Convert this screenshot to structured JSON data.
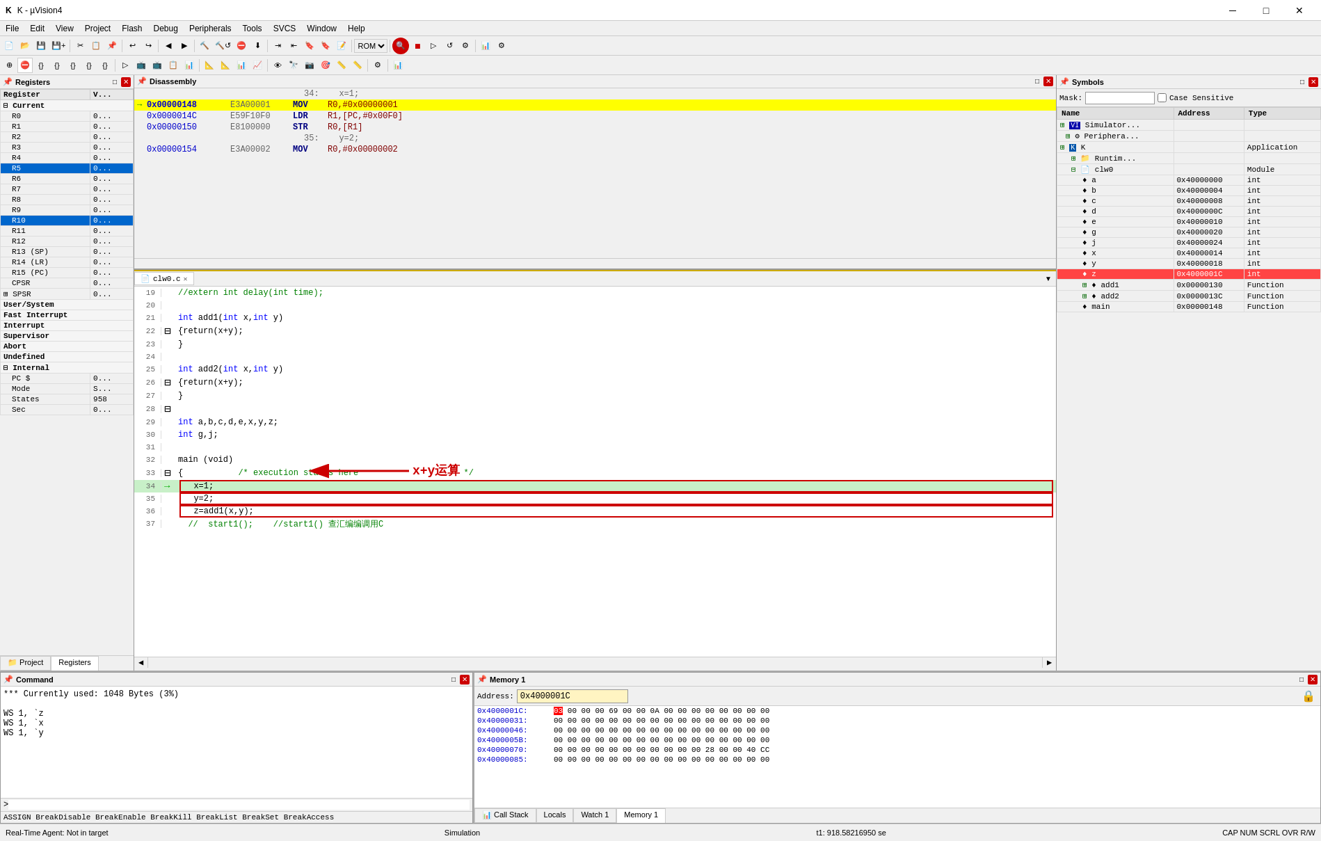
{
  "app": {
    "title": "K - µVision4",
    "icon": "K"
  },
  "menu": {
    "items": [
      "File",
      "Edit",
      "View",
      "Project",
      "Flash",
      "Debug",
      "Peripherals",
      "Tools",
      "SVCS",
      "Window",
      "Help"
    ]
  },
  "registers": {
    "title": "Registers",
    "columns": [
      "Register",
      "V..."
    ],
    "groups": [
      {
        "name": "Current",
        "items": [
          {
            "name": "R0",
            "value": "0..."
          },
          {
            "name": "R1",
            "value": "0..."
          },
          {
            "name": "R2",
            "value": "0..."
          },
          {
            "name": "R3",
            "value": "0..."
          },
          {
            "name": "R4",
            "value": "0..."
          },
          {
            "name": "R5",
            "value": "0...",
            "selected": true
          },
          {
            "name": "R6",
            "value": "0..."
          },
          {
            "name": "R7",
            "value": "0..."
          },
          {
            "name": "R8",
            "value": "0..."
          },
          {
            "name": "R9",
            "value": "0..."
          },
          {
            "name": "R10",
            "value": "0...",
            "selected": true
          },
          {
            "name": "R11",
            "value": "0..."
          },
          {
            "name": "R12",
            "value": "0..."
          },
          {
            "name": "R13 (SP)",
            "value": "0..."
          },
          {
            "name": "R14 (LR)",
            "value": "0..."
          },
          {
            "name": "R15 (PC)",
            "value": "0..."
          },
          {
            "name": "CPSR",
            "value": "0..."
          }
        ]
      },
      {
        "name": "+ SPSR",
        "value": "0..."
      },
      {
        "name": "User/System"
      },
      {
        "name": "Fast Interrupt"
      },
      {
        "name": "Interrupt"
      },
      {
        "name": "Supervisor"
      },
      {
        "name": "Abort"
      },
      {
        "name": "Undefined"
      },
      {
        "name": "Internal",
        "items": [
          {
            "name": "PC $",
            "value": "0..."
          },
          {
            "name": "Mode",
            "value": "S..."
          },
          {
            "name": "States",
            "value": "958"
          },
          {
            "name": "Sec",
            "value": "0..."
          }
        ]
      }
    ],
    "bottom_tabs": [
      "Project",
      "Registers"
    ]
  },
  "disassembly": {
    "title": "Disassembly",
    "rows": [
      {
        "lineno": "34:",
        "comment": "x=1;",
        "addr": "",
        "hex": "",
        "mnem": "",
        "ops": "",
        "type": "comment"
      },
      {
        "addr": "0x00000148",
        "hex": "E3A00001",
        "mnem": "MOV",
        "ops": "R0,#0x00000001",
        "type": "highlight-yellow"
      },
      {
        "addr": "0x0000014C",
        "hex": "E59F10F0",
        "mnem": "LDR",
        "ops": "R1,[PC,#0x00F0]",
        "type": "normal"
      },
      {
        "addr": "0x00000150",
        "hex": "E8100000",
        "mnem": "STR",
        "ops": "R0,[R1]",
        "type": "normal"
      },
      {
        "lineno": "35:",
        "comment": "y=2;",
        "addr": "",
        "hex": "",
        "mnem": "",
        "ops": "",
        "type": "comment"
      },
      {
        "addr": "0x00000154",
        "hex": "E3A00002",
        "mnem": "MOV",
        "ops": "R0,#0x00000002",
        "type": "normal"
      }
    ]
  },
  "editor": {
    "title": "clw0.c",
    "tab_label": "clw0.c",
    "lines": [
      {
        "num": 19,
        "text": "//extern int delay(int time);",
        "type": "comment"
      },
      {
        "num": 20,
        "text": ""
      },
      {
        "num": 21,
        "text": "int add1(int x,int y)",
        "type": "code"
      },
      {
        "num": 22,
        "text": "{return(x+y);",
        "type": "code",
        "fold": true
      },
      {
        "num": 23,
        "text": "}",
        "type": "code"
      },
      {
        "num": 24,
        "text": ""
      },
      {
        "num": 25,
        "text": "int add2(int x,int y)",
        "type": "code"
      },
      {
        "num": 26,
        "text": "{return(x+y);",
        "type": "code",
        "fold": true
      },
      {
        "num": 27,
        "text": "}",
        "type": "code"
      },
      {
        "num": 28,
        "text": ""
      },
      {
        "num": 29,
        "text": "int a,b,c,d,e,x,y,z;",
        "type": "code"
      },
      {
        "num": 30,
        "text": "int g,j;",
        "type": "code"
      },
      {
        "num": 31,
        "text": ""
      },
      {
        "num": 32,
        "text": "main (void)",
        "type": "code"
      },
      {
        "num": 33,
        "text": "{",
        "comment": "/* execution starts here                    */",
        "type": "code",
        "fold": true
      },
      {
        "num": 34,
        "text": "  x=1;",
        "type": "highlighted",
        "arrow": true
      },
      {
        "num": 35,
        "text": "  y=2;",
        "type": "normal"
      },
      {
        "num": 36,
        "text": "  z=add1(x,y);",
        "type": "normal"
      },
      {
        "num": 37,
        "text": "  //  start1();",
        "comment": "//start1() 查汇编调用C",
        "type": "comment"
      }
    ],
    "annotation": "x+y运算"
  },
  "symbols": {
    "title": "Symbols",
    "mask_label": "Mask:",
    "case_sensitive_label": "Case Sensitive",
    "columns": [
      "Name",
      "Address",
      "Type"
    ],
    "tree": [
      {
        "icon": "VI",
        "name": "Simulator...",
        "level": 1,
        "expand": true
      },
      {
        "icon": "gear",
        "name": "Periphera...",
        "level": 1,
        "expand": true
      },
      {
        "icon": "K",
        "name": "K",
        "level": 1,
        "expand": true,
        "value": "Application"
      },
      {
        "name": "Runtim...",
        "level": 2,
        "expand": true
      },
      {
        "name": "clw0",
        "level": 2,
        "expand": true,
        "value": "Module"
      },
      {
        "name": "a",
        "level": 3,
        "addr": "0x40000000",
        "type": "int"
      },
      {
        "name": "b",
        "level": 3,
        "addr": "0x40000004",
        "type": "int"
      },
      {
        "name": "c",
        "level": 3,
        "addr": "0x40000008",
        "type": "int"
      },
      {
        "name": "d",
        "level": 3,
        "addr": "0x4000000C",
        "type": "int"
      },
      {
        "name": "e",
        "level": 3,
        "addr": "0x40000010",
        "type": "int"
      },
      {
        "name": "g",
        "level": 3,
        "addr": "0x40000020",
        "type": "int"
      },
      {
        "name": "j",
        "level": 3,
        "addr": "0x40000024",
        "type": "int"
      },
      {
        "name": "x",
        "level": 3,
        "addr": "0x40000014",
        "type": "int"
      },
      {
        "name": "y",
        "level": 3,
        "addr": "0x40000018",
        "type": "int"
      },
      {
        "name": "z",
        "level": 3,
        "addr": "0x4000001C",
        "type": "int",
        "selected": true
      },
      {
        "name": "add1",
        "level": 3,
        "addr": "0x00000130",
        "type": "Function"
      },
      {
        "name": "add2",
        "level": 3,
        "addr": "0x0000013C",
        "type": "Function"
      },
      {
        "name": "main",
        "level": 3,
        "addr": "0x00000148",
        "type": "Function"
      }
    ]
  },
  "command": {
    "title": "Command",
    "content": [
      "*** Currently used: 1048 Bytes (3%)",
      "",
      "WS 1, `z",
      "WS 1, `x",
      "WS 1, `y"
    ],
    "autocomplete": "ASSIGN BreakDisable BreakEnable BreakKill BreakList BreakSet BreakAccess"
  },
  "memory": {
    "title": "Memory 1",
    "address_label": "Address:",
    "address_value": "0x4000001C",
    "rows": [
      {
        "addr": "0x4000001C:",
        "bytes": "03 00 00 00 69 00 00 0A 00 00 00 00 00 00 00 00",
        "highlight_byte": "03"
      },
      {
        "addr": "0x40000031:",
        "bytes": "00 00 00 00 00 00 00 00 00 00 00 00 00 00 00 00"
      },
      {
        "addr": "0x40000046:",
        "bytes": "00 00 00 00 00 00 00 00 00 00 00 00 00 00 00 00"
      },
      {
        "addr": "0x4000005B:",
        "bytes": "00 00 00 00 00 00 00 00 00 00 00 00 00 00 00 00"
      },
      {
        "addr": "0x40000070:",
        "bytes": "00 00 00 00 00 00 00 00 00 00 00 28 00 00 40 CC"
      },
      {
        "addr": "0x40000085:",
        "bytes": "00 00 00 00 00 00 00 00 00 00 00 00 00 00 00 00"
      }
    ],
    "tabs": [
      "Call Stack",
      "Locals",
      "Watch 1",
      "Memory 1"
    ]
  },
  "status_bar": {
    "simulation_status": "Real-Time Agent: Not in target",
    "mode": "Simulation",
    "time": "t1: 918.58216950 se",
    "caps": "CAP  NUM  SCRL  OVR  R/W"
  },
  "toolbar": {
    "rom_label": "ROM"
  }
}
